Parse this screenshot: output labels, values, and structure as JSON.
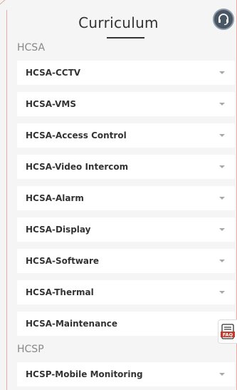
{
  "page": {
    "title": "Curriculum"
  },
  "sections": [
    {
      "label": "HCSA",
      "items": [
        {
          "label": "HCSA-CCTV"
        },
        {
          "label": "HCSA-VMS"
        },
        {
          "label": "HCSA-Access Control"
        },
        {
          "label": "HCSA-Video Intercom"
        },
        {
          "label": "HCSA-Alarm"
        },
        {
          "label": "HCSA-Display"
        },
        {
          "label": "HCSA-Software"
        },
        {
          "label": "HCSA-Thermal"
        },
        {
          "label": "HCSA-Maintenance"
        }
      ]
    },
    {
      "label": "HCSP",
      "items": [
        {
          "label": "HCSP-Mobile Monitoring"
        }
      ]
    }
  ],
  "floating": {
    "faq_label": "FAQ",
    "help_icon": "headset-icon"
  },
  "colors": {
    "accent": "#e6a9a3",
    "faq_red": "#c0392b",
    "background": "#f5f5f5"
  }
}
